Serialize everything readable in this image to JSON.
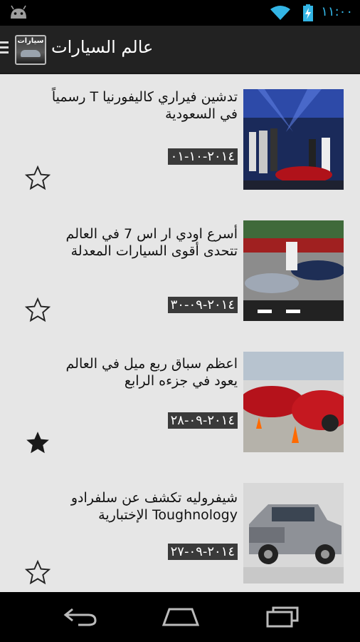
{
  "status": {
    "time": "١١:٠٠"
  },
  "actionbar": {
    "title": "عالم السيارات",
    "logo_text": "سيارات"
  },
  "articles": [
    {
      "headline": "تدشين فيراري كاليفورنيا T رسمياً في السعودية",
      "date": "٢٠١٤-١٠-٠١",
      "starred": false,
      "image": "ferrari-launch-photo"
    },
    {
      "headline": "أسرع اودي ار اس 7 في العالم تتحدى أقوى السيارات المعدلة",
      "date": "٢٠١٤-٠٩-٣٠",
      "starred": false,
      "image": "audi-rs7-race-photo"
    },
    {
      "headline": "اعظم سباق ربع ميل في العالم يعود في جزءه الرابع",
      "date": "٢٠١٤-٠٩-٢٨",
      "starred": true,
      "image": "quarter-mile-race-photo"
    },
    {
      "headline": "شيفروليه تكشف عن سلفرادو Toughnology الإختبارية",
      "date": "٢٠١٤-٠٩-٢٧",
      "starred": false,
      "image": "chevrolet-silverado-photo"
    }
  ]
}
